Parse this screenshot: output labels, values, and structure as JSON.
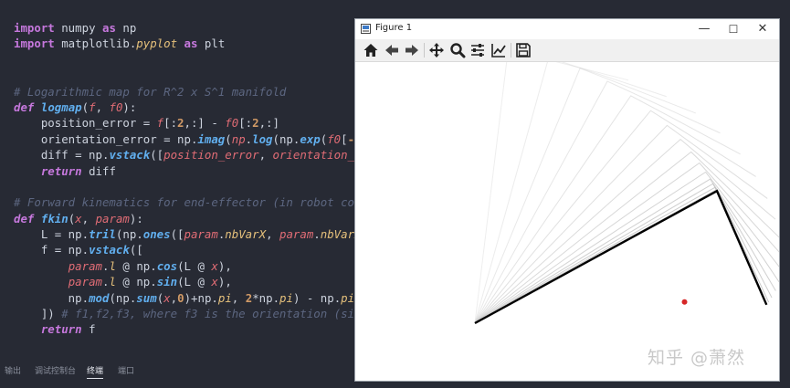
{
  "editor": {
    "lines": [
      [
        [
          "kwp",
          "import"
        ],
        [
          "ident",
          " numpy "
        ],
        [
          "kwp",
          "as"
        ],
        [
          "ident",
          " np"
        ]
      ],
      [
        [
          "kwp",
          "import"
        ],
        [
          "ident",
          " matplotlib."
        ],
        [
          "cls",
          "pyplot"
        ],
        [
          "ident",
          " "
        ],
        [
          "kwp",
          "as"
        ],
        [
          "ident",
          " plt"
        ]
      ],
      [],
      [],
      [
        [
          "cm",
          "# Logarithmic map for R^2 x S^1 manifold"
        ]
      ],
      [
        [
          "kw",
          "def"
        ],
        [
          "ident",
          " "
        ],
        [
          "fn",
          "logmap"
        ],
        [
          "ident",
          "("
        ],
        [
          "par",
          "f"
        ],
        [
          "ident",
          ", "
        ],
        [
          "par",
          "f0"
        ],
        [
          "ident",
          "):"
        ]
      ],
      [
        [
          "ident",
          "    position_error = "
        ],
        [
          "par",
          "f"
        ],
        [
          "ident",
          "[:"
        ],
        [
          "num",
          "2"
        ],
        [
          "ident",
          ",:] - "
        ],
        [
          "par",
          "f0"
        ],
        [
          "ident",
          "[:"
        ],
        [
          "num",
          "2"
        ],
        [
          "ident",
          ",:]"
        ]
      ],
      [
        [
          "ident",
          "    orientation_error = np."
        ],
        [
          "fn",
          "imag"
        ],
        [
          "ident",
          "("
        ],
        [
          "par",
          "np"
        ],
        [
          "ident",
          "."
        ],
        [
          "fn",
          "log"
        ],
        [
          "ident",
          "(np."
        ],
        [
          "fn",
          "exp"
        ],
        [
          "ident",
          "("
        ],
        [
          "par",
          "f0"
        ],
        [
          "ident",
          "["
        ],
        [
          "num",
          "-1"
        ]
      ],
      [
        [
          "ident",
          "    diff = np."
        ],
        [
          "fn",
          "vstack"
        ],
        [
          "ident",
          "(["
        ],
        [
          "par",
          "position_error"
        ],
        [
          "ident",
          ", "
        ],
        [
          "par",
          "orientation_er"
        ]
      ],
      [
        [
          "ident",
          "    "
        ],
        [
          "kw",
          "return"
        ],
        [
          "ident",
          " diff"
        ]
      ],
      [],
      [
        [
          "cm",
          "# Forward kinematics for end-effector (in robot coor"
        ]
      ],
      [
        [
          "kw",
          "def"
        ],
        [
          "ident",
          " "
        ],
        [
          "fn",
          "fkin"
        ],
        [
          "ident",
          "("
        ],
        [
          "par",
          "x"
        ],
        [
          "ident",
          ", "
        ],
        [
          "par",
          "param"
        ],
        [
          "ident",
          "):"
        ]
      ],
      [
        [
          "ident",
          "    L = np."
        ],
        [
          "fn",
          "tril"
        ],
        [
          "ident",
          "(np."
        ],
        [
          "fn",
          "ones"
        ],
        [
          "ident",
          "(["
        ],
        [
          "par",
          "param"
        ],
        [
          "ident",
          "."
        ],
        [
          "cls",
          "nbVarX"
        ],
        [
          "ident",
          ", "
        ],
        [
          "par",
          "param"
        ],
        [
          "ident",
          "."
        ],
        [
          "cls",
          "nbVarX"
        ]
      ],
      [
        [
          "ident",
          "    f = np."
        ],
        [
          "fn",
          "vstack"
        ],
        [
          "ident",
          "(["
        ]
      ],
      [
        [
          "ident",
          "        "
        ],
        [
          "par",
          "param"
        ],
        [
          "ident",
          "."
        ],
        [
          "cls",
          "l"
        ],
        [
          "ident",
          " @ np."
        ],
        [
          "fn",
          "cos"
        ],
        [
          "ident",
          "(L @ "
        ],
        [
          "par",
          "x"
        ],
        [
          "ident",
          "),"
        ]
      ],
      [
        [
          "ident",
          "        "
        ],
        [
          "par",
          "param"
        ],
        [
          "ident",
          "."
        ],
        [
          "cls",
          "l"
        ],
        [
          "ident",
          " @ np."
        ],
        [
          "fn",
          "sin"
        ],
        [
          "ident",
          "(L @ "
        ],
        [
          "par",
          "x"
        ],
        [
          "ident",
          "),"
        ]
      ],
      [
        [
          "ident",
          "        np."
        ],
        [
          "fn",
          "mod"
        ],
        [
          "ident",
          "(np."
        ],
        [
          "fn",
          "sum"
        ],
        [
          "ident",
          "("
        ],
        [
          "par",
          "x"
        ],
        [
          "ident",
          ","
        ],
        [
          "num",
          "0"
        ],
        [
          "ident",
          ")+np."
        ],
        [
          "cls",
          "pi"
        ],
        [
          "ident",
          ", "
        ],
        [
          "num",
          "2"
        ],
        [
          "ident",
          "*np."
        ],
        [
          "cls",
          "pi"
        ],
        [
          "ident",
          ") - np."
        ],
        [
          "cls",
          "pi"
        ]
      ],
      [
        [
          "ident",
          "    ]) "
        ],
        [
          "cm",
          "# f1,f2,f3, where f3 is the orientation (sing"
        ]
      ],
      [
        [
          "ident",
          "    "
        ],
        [
          "kw",
          "return"
        ],
        [
          "ident",
          " f"
        ]
      ]
    ]
  },
  "panel_tabs": [
    {
      "label": "输出",
      "active": false
    },
    {
      "label": "调试控制台",
      "active": false
    },
    {
      "label": "终端",
      "active": true
    },
    {
      "label": "端口",
      "active": false
    }
  ],
  "figure": {
    "window_title": "Figure 1",
    "controls": {
      "minimize": "—",
      "maximize": "☐",
      "close": "✕"
    },
    "toolbar_icons": [
      "home-icon",
      "back-arrow-icon",
      "forward-arrow-icon",
      "pan-icon",
      "zoom-icon",
      "configure-subplots-icon",
      "edit-axis-icon",
      "save-icon"
    ],
    "watermark": "知乎 @萧然",
    "colors": {
      "arm_final": "#000000",
      "arm_trail": "#bdbdbd",
      "target": "#d62728"
    }
  },
  "chart_data": {
    "type": "line",
    "description_units": "planar two-link arm configurations",
    "link_lengths": [
      1.0,
      0.45
    ],
    "base": [
      0,
      0
    ],
    "frames": [
      {
        "q1": 1.45,
        "q2": -1.7
      },
      {
        "q1": 1.3,
        "q2": -1.62
      },
      {
        "q1": 1.18,
        "q2": -1.55
      },
      {
        "q1": 1.07,
        "q2": -1.5
      },
      {
        "q1": 0.97,
        "q2": -1.46
      },
      {
        "q1": 0.88,
        "q2": -1.44
      },
      {
        "q1": 0.8,
        "q2": -1.43
      },
      {
        "q1": 0.73,
        "q2": -1.43
      },
      {
        "q1": 0.67,
        "q2": -1.44
      },
      {
        "q1": 0.62,
        "q2": -1.46
      },
      {
        "q1": 0.58,
        "q2": -1.49
      },
      {
        "q1": 0.55,
        "q2": -1.53
      },
      {
        "q1": 0.53,
        "q2": -1.57
      },
      {
        "q1": 0.515,
        "q2": -1.61
      },
      {
        "q1": 0.505,
        "q2": -1.64
      },
      {
        "q1": 0.5,
        "q2": -1.66
      }
    ],
    "target": [
      0.76,
      0.077
    ]
  }
}
